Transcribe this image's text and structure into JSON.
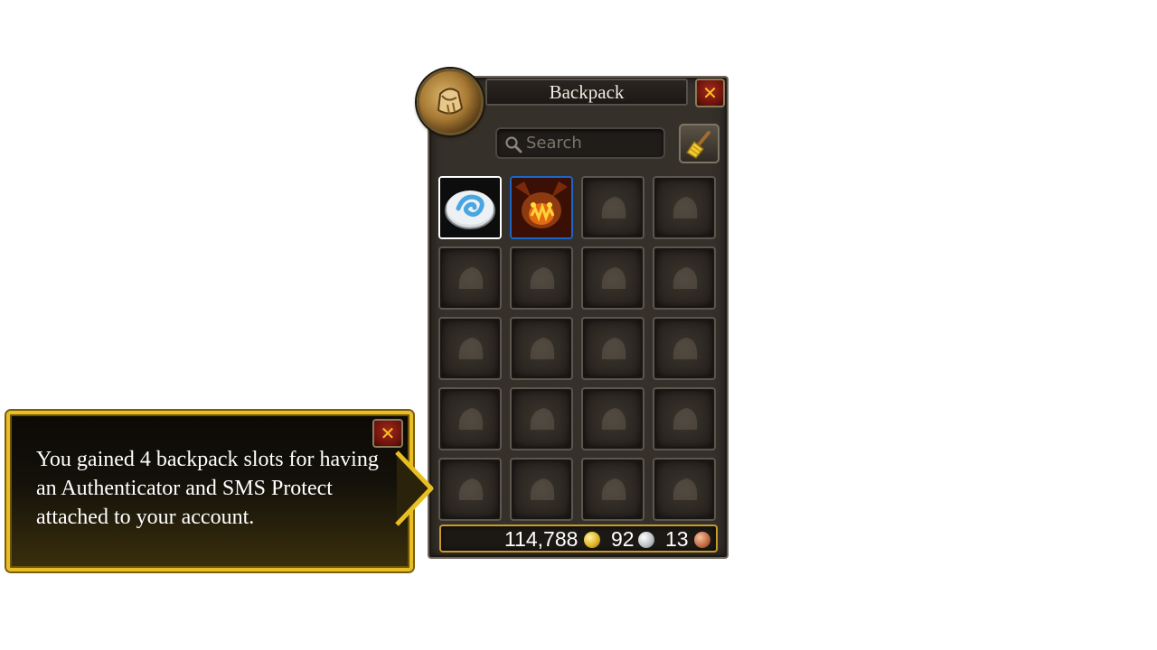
{
  "window": {
    "title": "Backpack",
    "close_label": "✕",
    "icon": "bag-icon"
  },
  "search": {
    "placeholder": "Search",
    "value": ""
  },
  "toolbar": {
    "cleanup_icon": "broom-icon"
  },
  "slots": [
    {
      "item": "hearthstone-icon",
      "border": "#ffffff"
    },
    {
      "item": "pet-icon",
      "border": "#1d66c8"
    },
    {
      "item": ""
    },
    {
      "item": ""
    },
    {
      "item": ""
    },
    {
      "item": ""
    },
    {
      "item": ""
    },
    {
      "item": ""
    },
    {
      "item": ""
    },
    {
      "item": ""
    },
    {
      "item": ""
    },
    {
      "item": ""
    },
    {
      "item": ""
    },
    {
      "item": ""
    },
    {
      "item": ""
    },
    {
      "item": ""
    },
    {
      "item": ""
    },
    {
      "item": ""
    },
    {
      "item": ""
    },
    {
      "item": ""
    }
  ],
  "money": {
    "gold": "114,788",
    "silver": "92",
    "copper": "13"
  },
  "tutorial": {
    "text": "You gained 4 backpack slots for having an Authenticator and SMS Protect attached to your account.",
    "close_label": "✕"
  },
  "colors": {
    "accent_gold": "#e8be22",
    "close_red": "#a3281c",
    "pet_border": "#1d66c8"
  }
}
